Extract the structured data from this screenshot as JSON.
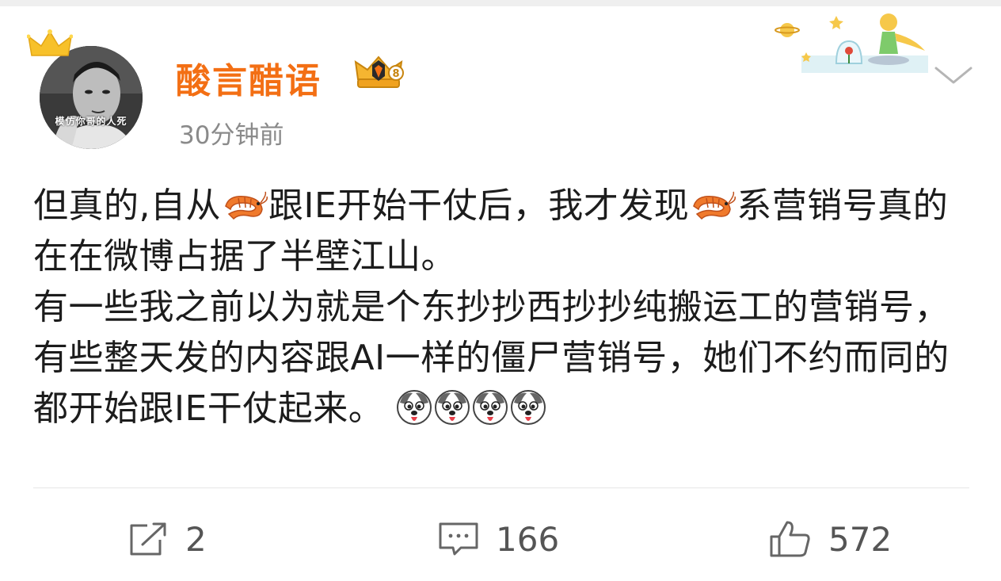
{
  "header": {
    "username": "酸言醋语",
    "timestamp": "30分钟前",
    "avatar_caption": "模仿你哥的人死",
    "avatar_icon": "avatar",
    "vip_icon": "crown-vip-badge-icon",
    "menu_icon": "chevron-down-icon"
  },
  "post": {
    "line1": {
      "a": "但真的,自从",
      "b": "跟IE开始干仗后，我才发现",
      "c": "系营销号真的在在微博占据了半壁江山。"
    },
    "line2": {
      "a": "有一些我之前以为就是个东抄抄西抄抄纯搬运工的营销号，有些整天发的内容跟AI一样的僵尸营销号，她们不约而同的都开始跟IE干仗起来。"
    },
    "emoji_icons": [
      "shrimp-emoji-icon",
      "husky-emoji-icon"
    ]
  },
  "actions": {
    "repost_count": "2",
    "comment_count": "166",
    "like_count": "572"
  },
  "colors": {
    "username": "#f36f14",
    "timestamp": "#8a8a8a",
    "text": "#1c1c1c",
    "actions": "#555555"
  }
}
